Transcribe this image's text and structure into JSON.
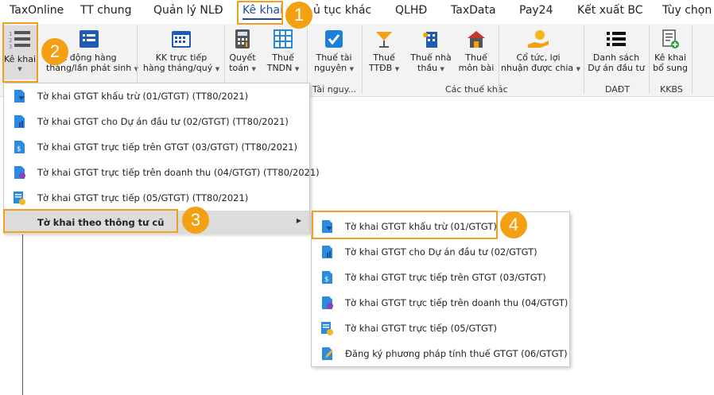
{
  "tabs": [
    "TaxOnline",
    "TT chung",
    "Quản lý NLĐ",
    "Kê khai",
    "ủ tục khác",
    "QLHĐ",
    "TaxData",
    "Pay24",
    "Kết xuất BC",
    "Tùy chọn"
  ],
  "ribbon": {
    "ke_khai": "Kê khai",
    "tu_dong": [
      "ự động hàng",
      "tháng/lần phát sinh"
    ],
    "kk_truc_tiep": [
      "KK trực tiếp",
      "hàng tháng/quý"
    ],
    "quyet_toan": [
      "Quyết",
      "toán"
    ],
    "thue_tndn": [
      "Thuế",
      "TNDN"
    ],
    "thue_tai_nguyen": [
      "Thuế tài",
      "nguyên"
    ],
    "thue_ttdb": [
      "Thuế",
      "TTĐB"
    ],
    "thue_nha_thau": [
      "Thuế nhà",
      "thầu"
    ],
    "thue_mon_bai": [
      "Thuế",
      "môn bài"
    ],
    "co_tuc": [
      "Cổ tức, lợi",
      "nhuận được chia"
    ],
    "danh_sach": [
      "Danh sách",
      "Dự án đầu tư"
    ],
    "ke_khai_bs": [
      "Kê khai",
      "bổ sung"
    ],
    "groups": {
      "tai_nguyen": "Tài nguy...",
      "cac_thue_khac": "Các thuế khác",
      "daDT": "DAĐT",
      "kkbs": "KKBS"
    }
  },
  "menu1": [
    "Tờ khai GTGT khấu trừ (01/GTGT) (TT80/2021)",
    "Tờ khai GTGT cho Dự án đầu tư (02/GTGT) (TT80/2021)",
    "Tờ khai GTGT trực tiếp trên GTGT (03/GTGT) (TT80/2021)",
    "Tờ khai GTGT trực tiếp trên doanh thu (04/GTGT) (TT80/2021)",
    "Tờ khai GTGT trực tiếp (05/GTGT) (TT80/2021)",
    "Tờ khai theo thông tư cũ"
  ],
  "menu2": [
    "Tờ khai GTGT khấu trừ (01/GTGT)",
    "Tờ khai GTGT cho Dự án đầu tư (02/GTGT)",
    "Tờ khai GTGT trực tiếp trên GTGT (03/GTGT)",
    "Tờ khai GTGT trực tiếp trên doanh thu (04/GTGT)",
    "Tờ khai GTGT trực tiếp (05/GTGT)",
    "Đăng ký phương pháp tính thuế GTGT (06/GTGT)"
  ],
  "badges": [
    "1",
    "2",
    "3",
    "4"
  ],
  "colors": {
    "accent": "#1d4fa0",
    "highlight": "#f0a020",
    "badge": "#f3a012"
  }
}
